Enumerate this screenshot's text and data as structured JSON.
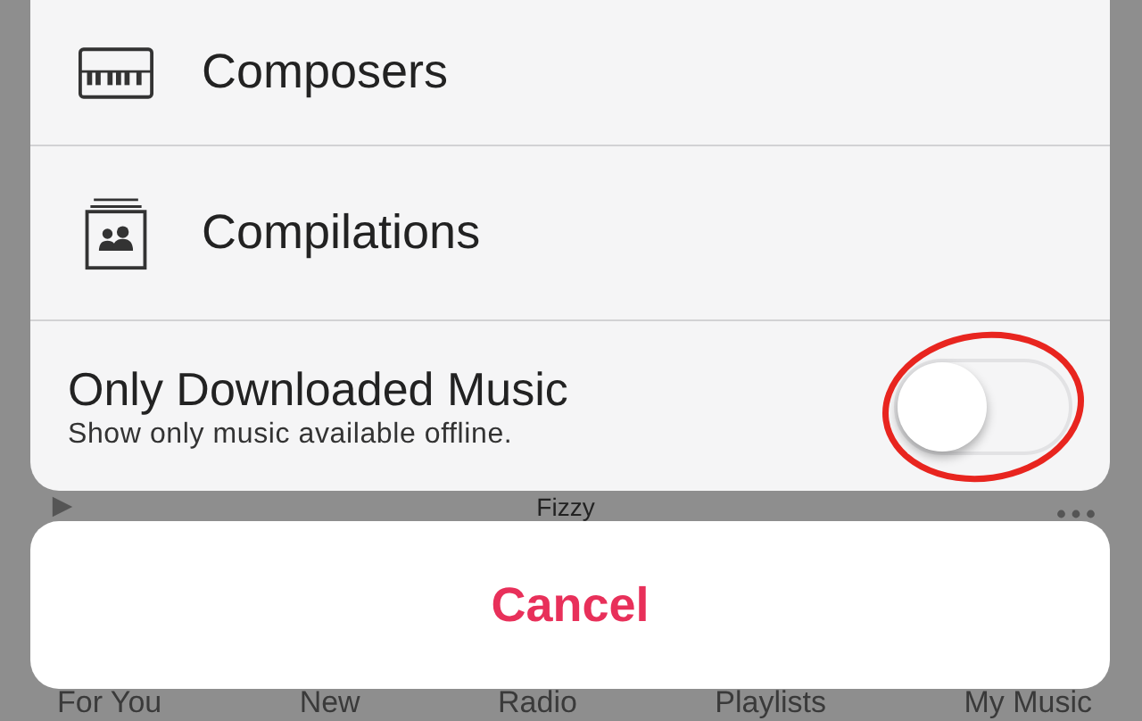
{
  "menu": {
    "items": [
      {
        "label": "Composers"
      },
      {
        "label": "Compilations"
      }
    ],
    "toggle": {
      "title": "Only Downloaded Music",
      "subtitle": "Show only music available offline.",
      "on": false
    }
  },
  "mini_player": {
    "title": "Fizzy"
  },
  "cancel_button": {
    "label": "Cancel"
  },
  "tab_bar": {
    "tabs": [
      {
        "label": "For You"
      },
      {
        "label": "New"
      },
      {
        "label": "Radio"
      },
      {
        "label": "Playlists"
      },
      {
        "label": "My Music"
      }
    ]
  }
}
